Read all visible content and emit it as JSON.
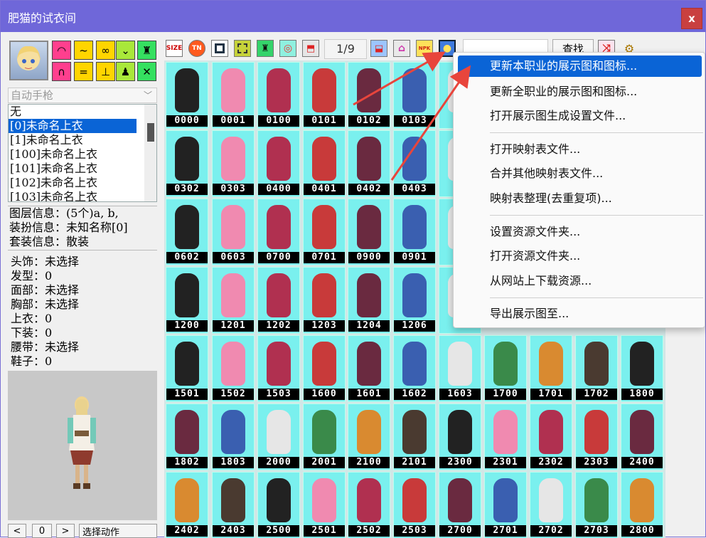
{
  "window": {
    "title": "肥猫的试衣间",
    "close_label": "x"
  },
  "left": {
    "weapon_placeholder": "自动手枪",
    "list_items": [
      "无",
      "[0]未命名上衣",
      "[1]未命名上衣",
      "[100]未命名上衣",
      "[101]未命名上衣",
      "[102]未命名上衣",
      "[103]未命名上衣"
    ],
    "info_lines": [
      "图层信息：(5个)a, b,",
      "装扮信息：未知名称[0]",
      "套装信息：散装"
    ],
    "equip_lines": [
      "头饰：未选择",
      "发型：0",
      "面部：未选择",
      "胸部：未选择",
      "上衣：0",
      "下装：0",
      "腰带：未选择",
      "鞋子：0"
    ],
    "frame_value": "0",
    "action_select": "选择动作"
  },
  "toolbar": {
    "page": "1/9",
    "search_value": "",
    "search_label": "查找",
    "icons": [
      "size-icon",
      "tn-icon",
      "frame-icon",
      "grid-icon",
      "shirt-swap-icon",
      "target-icon",
      "export-icon",
      "page-prev-icon",
      "gift-icon",
      "npk-icon",
      "globe-icon",
      "shuffle-icon",
      "gear-icon"
    ]
  },
  "grid": {
    "codes": [
      "0000",
      "0001",
      "0100",
      "0101",
      "0102",
      "0103",
      "",
      "0302",
      "0303",
      "0400",
      "0401",
      "0402",
      "0403",
      "",
      "0602",
      "0603",
      "0700",
      "0701",
      "0900",
      "0901",
      "",
      "1200",
      "1201",
      "1202",
      "1203",
      "1204",
      "1206",
      "",
      "1501",
      "1502",
      "1503",
      "1600",
      "1601",
      "1602",
      "1603",
      "1700",
      "1701",
      "1702",
      "1800",
      "1802",
      "1803",
      "2000",
      "2001",
      "2100",
      "2101",
      "2300",
      "2301",
      "2302",
      "2303",
      "2400",
      "2402",
      "2403",
      "2500",
      "2501",
      "2502",
      "2503",
      "2700",
      "2701",
      "2702",
      "2703",
      "2800"
    ]
  },
  "menu": {
    "items": [
      "更新本职业的展示图和图标...",
      "更新全职业的展示图和图标...",
      "打开展示图生成设置文件...",
      "打开映射表文件...",
      "合并其他映射表文件...",
      "映射表整理(去重复项)...",
      "设置资源文件夹...",
      "打开资源文件夹...",
      "从网站上下载资源...",
      "导出展示图至..."
    ]
  },
  "colors": {
    "titlebar": "#6f67d9",
    "cell_bg": "#7af0ee",
    "highlight": "#0a64d6",
    "arrow": "#e8453c"
  }
}
